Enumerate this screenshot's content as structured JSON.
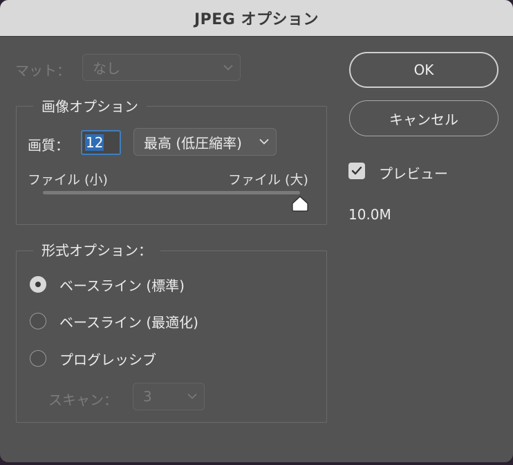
{
  "title": "JPEG オプション",
  "matte": {
    "label": "マット：",
    "value": "なし"
  },
  "image_options": {
    "legend": "画像オプション",
    "quality_label": "画質：",
    "quality_value": "12",
    "quality_preset": "最高 (低圧縮率)",
    "small_file_label": "ファイル (小)",
    "large_file_label": "ファイル (大)",
    "slider_fraction": 1.0
  },
  "format_options": {
    "legend": "形式オプション：",
    "options": [
      {
        "label": "ベースライン (標準)",
        "checked": true
      },
      {
        "label": "ベースライン (最適化)",
        "checked": false
      },
      {
        "label": "プログレッシブ",
        "checked": false
      }
    ],
    "scan_label": "スキャン：",
    "scan_value": "3"
  },
  "buttons": {
    "ok": "OK",
    "cancel": "キャンセル"
  },
  "preview": {
    "label": "プレビュー",
    "checked": true
  },
  "file_size": "10.0M",
  "colors": {
    "dialog_bg": "#535353",
    "title_bg": "#d9d9d9",
    "focus_ring": "#3f7fbf"
  }
}
